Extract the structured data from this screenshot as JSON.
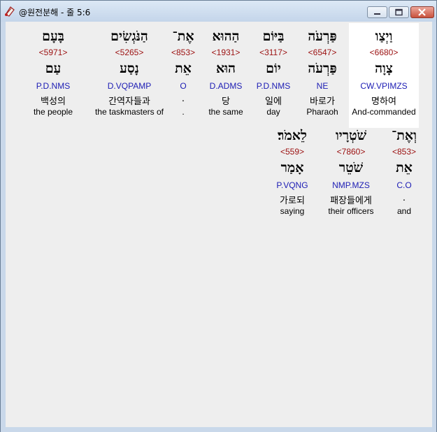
{
  "window": {
    "title": "@원전분해 - 줄 5:6"
  },
  "rows": [
    {
      "words": [
        {
          "heb": "וַיְצַו",
          "strong": "<6680>",
          "lex": "צָוָה",
          "parse": "CW.VPIMZS",
          "kor": "명하여",
          "eng": "And-commanded",
          "selected": true
        },
        {
          "heb": "פַּרְעֹה",
          "strong": "<6547>",
          "lex": "פַּרְעֹה",
          "parse": "NE",
          "kor": "바로가",
          "eng": "Pharaoh"
        },
        {
          "heb": "בַּיּוֹם",
          "strong": "<3117>",
          "lex": "יוֹם",
          "parse": "P.D.NMS",
          "kor": "일에",
          "eng": "day"
        },
        {
          "heb": "הַהוּא",
          "strong": "<1931>",
          "lex": "הוּא",
          "parse": "D.ADMS",
          "kor": "당",
          "eng": "the same"
        },
        {
          "heb": "אֶת־",
          "strong": "<853>",
          "lex": "אֵת",
          "parse": "O",
          "kor": ".",
          "eng": "."
        },
        {
          "heb": "הַנֹּגְשִׂים",
          "strong": "<5265>",
          "lex": "נָסַע",
          "parse": "D.VQPAMP",
          "kor": "간역자들과",
          "eng": "the taskmasters of"
        },
        {
          "heb": "בָּעָם",
          "strong": "<5971>",
          "lex": "עַם",
          "parse": "P.D.NMS",
          "kor": "백성의",
          "eng": "the people"
        }
      ]
    },
    {
      "words": [
        {
          "heb": "וְאֶת־",
          "strong": "<853>",
          "lex": "אֵת",
          "parse": "C.O",
          "kor": ".",
          "eng": "and"
        },
        {
          "heb": "שֹׁטְרָיו",
          "strong": "<7860>",
          "lex": "שֹׁטֵר",
          "parse": "NMP.MZS",
          "kor": "패장들에게",
          "eng": "their officers"
        },
        {
          "heb": "לֵאמֹר׃",
          "strong": "<559>",
          "lex": "אָמַר",
          "parse": "P.VQNG",
          "kor": "가로되",
          "eng": "saying"
        }
      ]
    }
  ]
}
